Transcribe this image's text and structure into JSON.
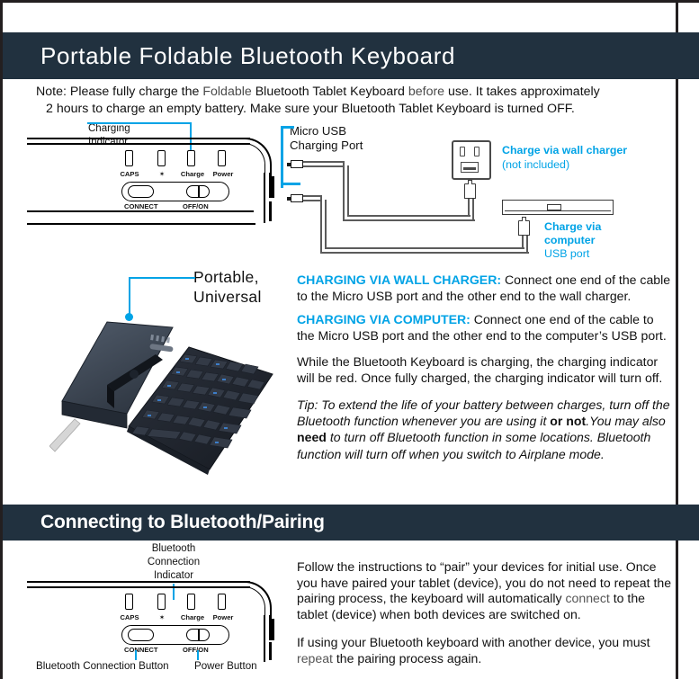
{
  "colors": {
    "header_bar": "#21313f",
    "accent_blue": "#00a3e6",
    "frame": "#231f20",
    "body_text": "#111111"
  },
  "sections": [
    {
      "id": "charging",
      "title": "Portable Foldable Bluetooth Keyboard"
    },
    {
      "id": "pairing",
      "title": "Connecting to Bluetooth/Pairing"
    }
  ],
  "note": {
    "line1_a": "Note: Please fully charge the ",
    "line1_light1": "Foldable",
    "line1_b": " Bluetooth Tablet Keyboard ",
    "line1_light2": "before",
    "line1_c": " use. It takes approximately",
    "line2": "2 hours to charge an empty battery. Make sure your Bluetooth Tablet Keyboard is turned OFF."
  },
  "keyboard_diagram_top": {
    "callout_line1": "Charging",
    "callout_line2": "Indicator",
    "leds": [
      "CAPS",
      "✶",
      "Charge",
      "Power"
    ],
    "switch_left_label": "CONNECT",
    "switch_right_label": "OFF/ON"
  },
  "charging_diagram": {
    "port_label_line1": "Micro USB",
    "port_label_line2": "Charging Port",
    "wall_label": "Charge via wall charger",
    "wall_sub": "(not included)",
    "computer_label_line1": "Charge via",
    "computer_label_line2": "computer",
    "computer_sub": "USB port"
  },
  "photo_callout": {
    "line1": "Portable,",
    "line2": "Universal"
  },
  "body_copy": {
    "wall_heading": "CHARGING VIA WALL CHARGER:",
    "wall_text": " Connect one end of the cable to the Micro USB port and the other end to the wall charger.",
    "computer_heading": "CHARGING VIA COMPUTER:",
    "computer_text": " Connect one end of the cable to the Micro USB port and the other end to the computer’s USB port.",
    "indicator_text": "While the Bluetooth Keyboard is charging, the charging indicator will be red. Once fully charged, the charging indicator will turn off.",
    "tip_a": "Tip: To extend the life of your battery between charges, turn off the Bluetooth function whenever you are using it ",
    "tip_bold1": "or not",
    "tip_b": ".You may also ",
    "tip_bold2": "need",
    "tip_c": " to turn off Bluetooth function in some locations. Bluetooth function will turn off when you switch to Airplane mode."
  },
  "keyboard_diagram_bottom": {
    "callout_line1": "Bluetooth",
    "callout_line2": "Connection",
    "callout_line3": "Indicator",
    "leds": [
      "CAPS",
      "✶",
      "Charge",
      "Power"
    ],
    "switch_left_label": "CONNECT",
    "switch_right_label": "OFF/ON",
    "foot_left": "Bluetooth Connection Button",
    "foot_right": "Power Button"
  },
  "pairing_copy": {
    "para1_a": "Follow the instructions to “pair” your devices for initial use. Once you have paired your tablet (device), you do not need to repeat the pairing process, the keyboard will automatically ",
    "para1_light": "connect",
    "para1_b": " to the tablet (device) when both devices are switched on.",
    "para2_a": "If using your Bluetooth keyboard with another device, you must ",
    "para2_light": "repeat",
    "para2_b": " the pairing process again."
  }
}
